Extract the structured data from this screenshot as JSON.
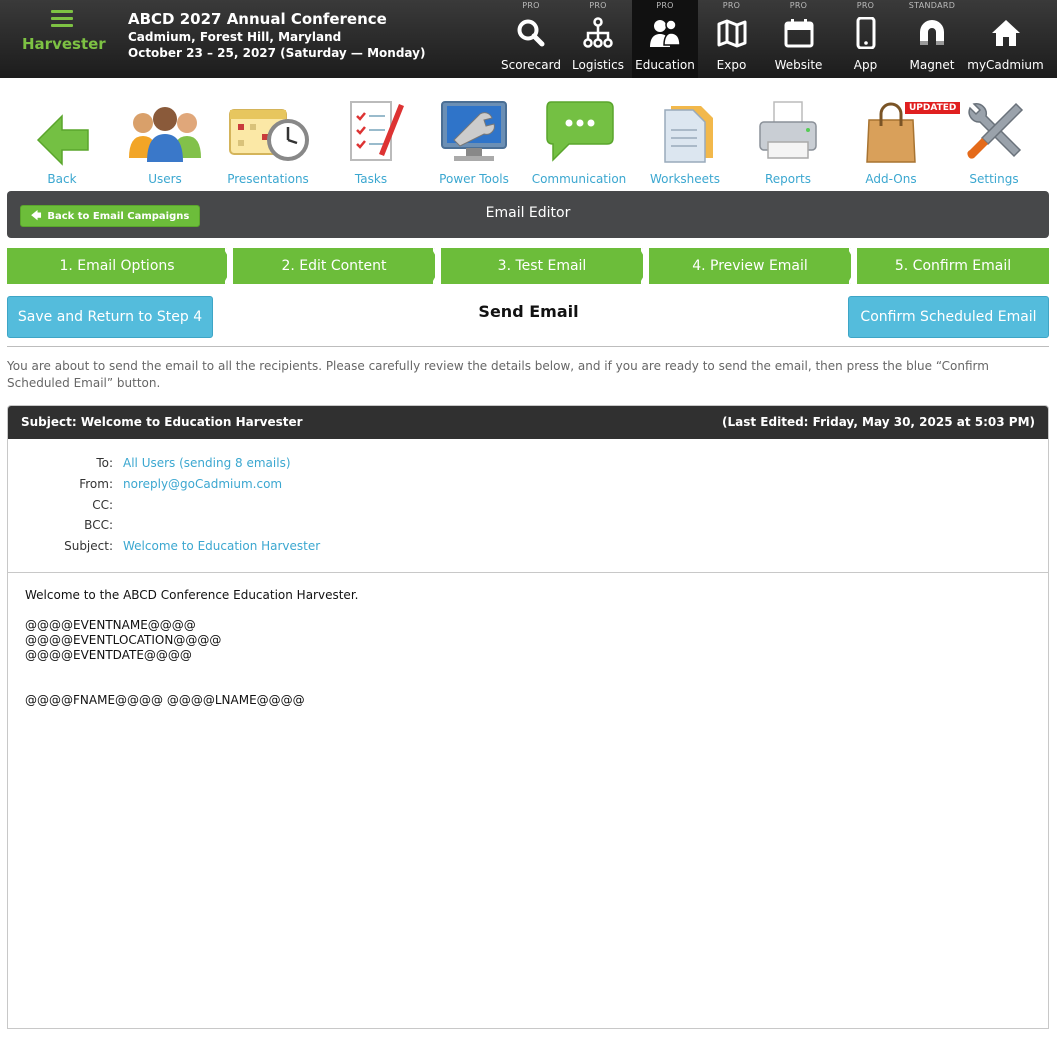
{
  "brand": {
    "label": "Harvester"
  },
  "conference": {
    "title": "ABCD 2027 Annual Conference",
    "location": "Cadmium, Forest Hill, Maryland",
    "dates": "October 23 – 25, 2027 (Saturday — Monday)"
  },
  "topnav": [
    {
      "label": "Scorecard",
      "tier": "PRO",
      "icon": "search-icon"
    },
    {
      "label": "Logistics",
      "tier": "PRO",
      "icon": "sitemap-icon"
    },
    {
      "label": "Education",
      "tier": "PRO",
      "icon": "users-icon",
      "active": true
    },
    {
      "label": "Expo",
      "tier": "PRO",
      "icon": "map-icon"
    },
    {
      "label": "Website",
      "tier": "PRO",
      "icon": "calendar-icon"
    },
    {
      "label": "App",
      "tier": "PRO",
      "icon": "phone-icon"
    },
    {
      "label": "Magnet",
      "tier": "STANDARD",
      "icon": "magnet-icon"
    },
    {
      "label": "myCadmium",
      "tier": "",
      "icon": "home-icon"
    }
  ],
  "modules": [
    {
      "label": "Back",
      "icon": "back-arrow-icon"
    },
    {
      "label": "Users",
      "icon": "people-icon"
    },
    {
      "label": "Presentations",
      "icon": "calendar-clock-icon"
    },
    {
      "label": "Tasks",
      "icon": "checklist-icon"
    },
    {
      "label": "Power Tools",
      "icon": "monitor-wrench-icon"
    },
    {
      "label": "Communication",
      "icon": "chat-bubble-icon"
    },
    {
      "label": "Worksheets",
      "icon": "folder-icon"
    },
    {
      "label": "Reports",
      "icon": "printer-icon"
    },
    {
      "label": "Add-Ons",
      "icon": "shopping-bag-icon",
      "badge": "UPDATED"
    },
    {
      "label": "Settings",
      "icon": "tools-icon"
    }
  ],
  "editor": {
    "back_label": "Back to Email Campaigns",
    "title": "Email Editor"
  },
  "steps": [
    {
      "label": "1. Email Options"
    },
    {
      "label": "2. Edit Content"
    },
    {
      "label": "3. Test Email"
    },
    {
      "label": "4. Preview Email"
    },
    {
      "label": "5. Confirm Email"
    }
  ],
  "actions": {
    "save_label": "Save and Return to Step 4",
    "send_title": "Send Email",
    "confirm_label": "Confirm Scheduled Email"
  },
  "notice": "You are about to send the email to all the recipients. Please carefully review the details below, and if you are ready to send the email, then press the blue “Confirm Scheduled Email” button.",
  "email": {
    "subject_header": "Subject: Welcome to Education Harvester",
    "last_edited": "(Last Edited: Friday, May 30, 2025 at 5:03 PM)",
    "meta": [
      {
        "key": "To:",
        "value": "All Users (sending 8 emails)"
      },
      {
        "key": "From:",
        "value": "noreply@goCadmium.com"
      },
      {
        "key": "CC:",
        "value": ""
      },
      {
        "key": "BCC:",
        "value": ""
      },
      {
        "key": "Subject:",
        "value": "Welcome to Education Harvester"
      }
    ],
    "body_lines": [
      "Welcome to the ABCD Conference Education Harvester.",
      "",
      "@@@@EVENTNAME@@@@",
      "@@@@EVENTLOCATION@@@@",
      "@@@@EVENTDATE@@@@",
      "",
      "",
      "@@@@FNAME@@@@ @@@@LNAME@@@@"
    ]
  },
  "colors": {
    "green": "#6cbd3a",
    "blue": "#54bcdc",
    "link": "#3ba7d0",
    "dark": "#303030"
  }
}
